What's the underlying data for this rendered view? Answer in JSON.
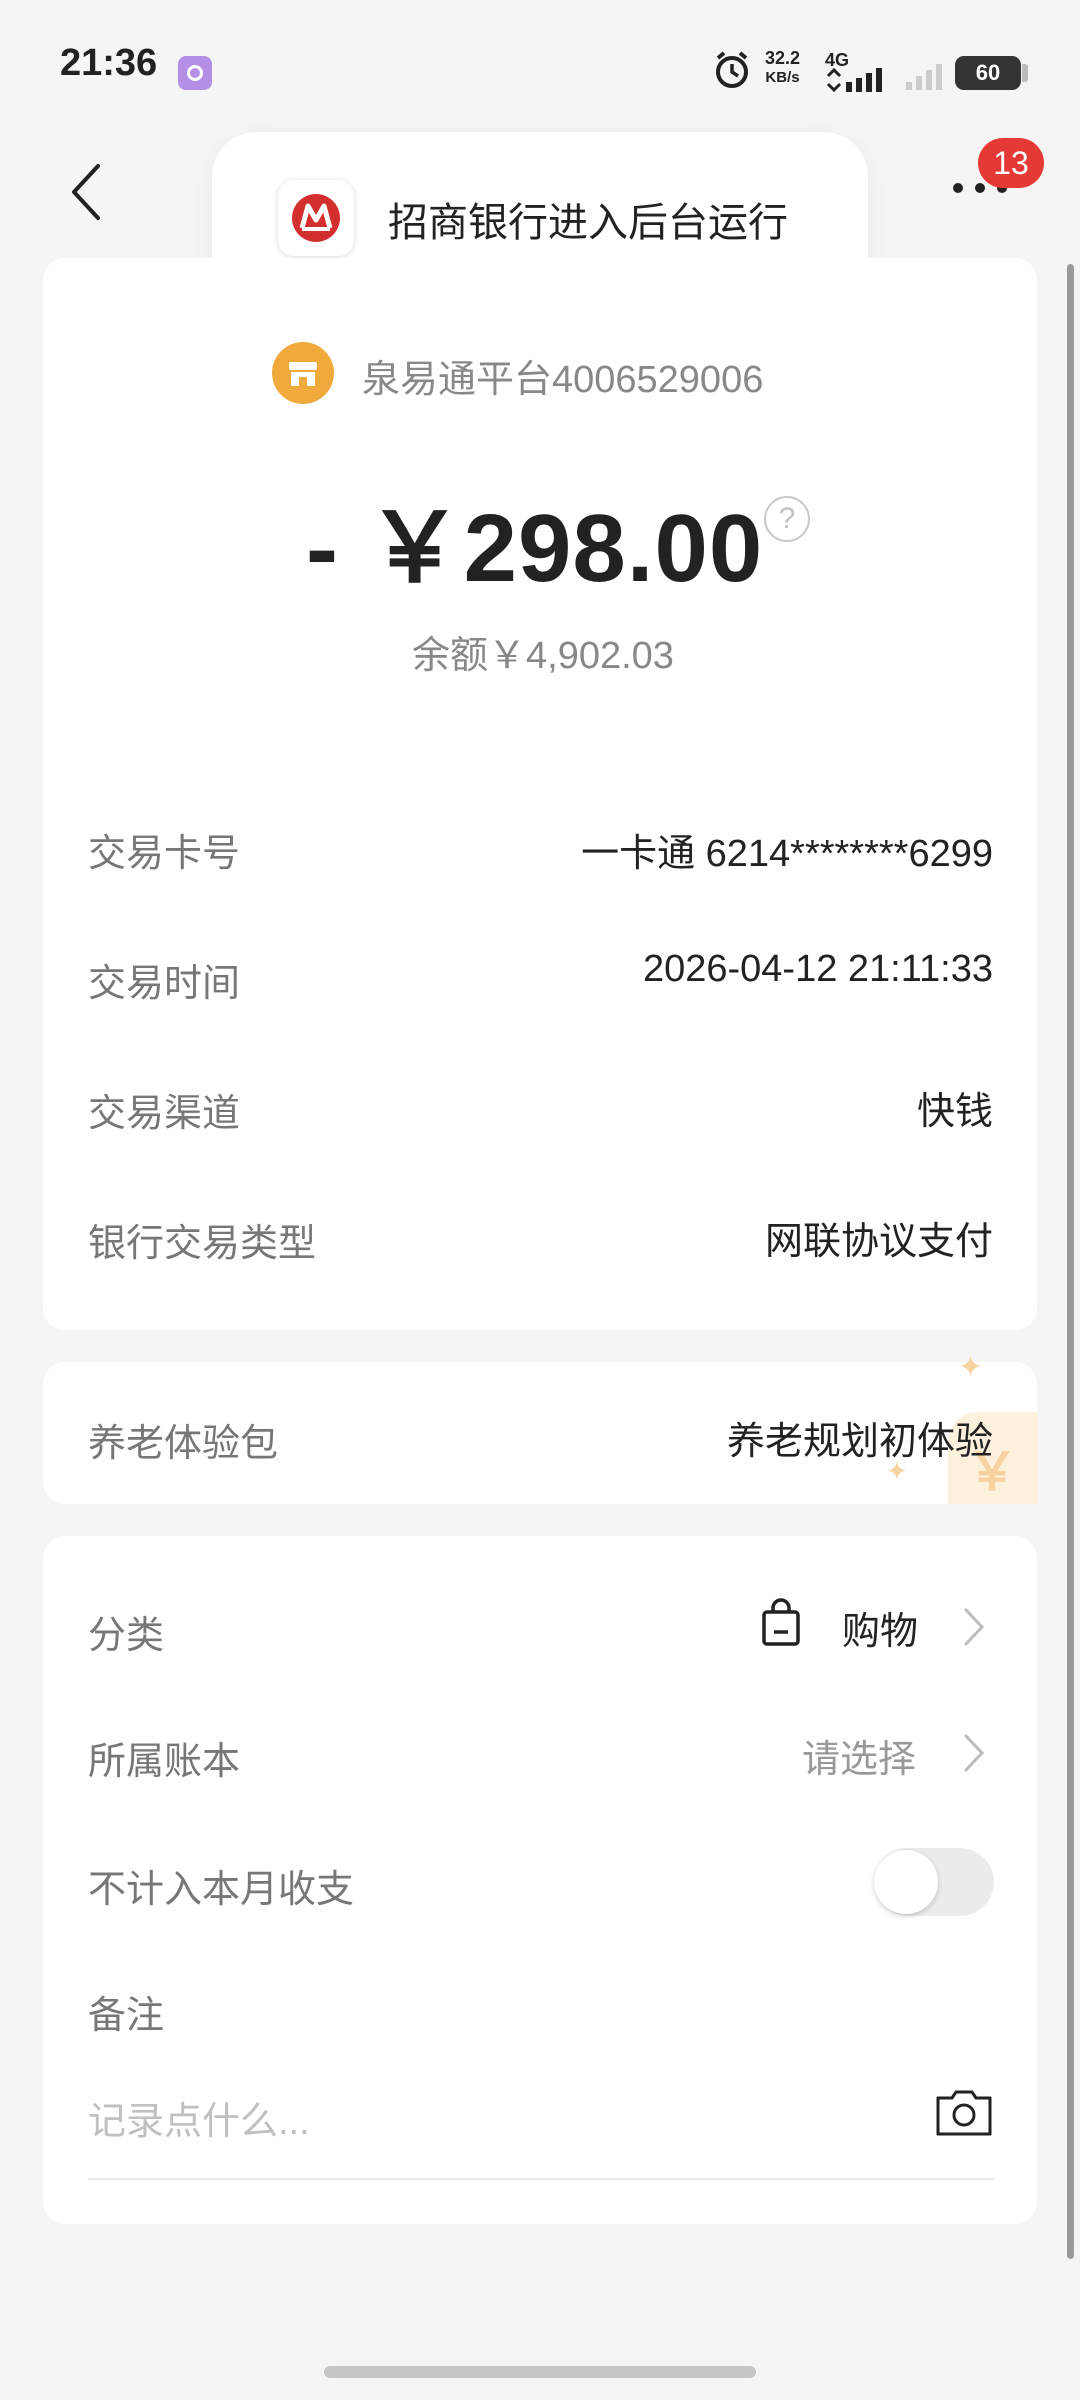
{
  "status_bar": {
    "time": "21:36",
    "net_speed_value": "32.2",
    "net_speed_unit": "KB/s",
    "network_type": "4G",
    "battery": "60"
  },
  "nav": {
    "badge_count": "13"
  },
  "toast": {
    "text": "招商银行进入后台运行"
  },
  "transaction": {
    "merchant": "泉易通平台4006529006",
    "amount": "- ￥298.00",
    "balance": "余额￥4,902.03",
    "details": [
      {
        "label": "交易卡号",
        "value": "一卡通 6214********6299"
      },
      {
        "label": "交易时间",
        "value": "2026-04-12 21:11:33"
      },
      {
        "label": "交易渠道",
        "value": "快钱"
      },
      {
        "label": "银行交易类型",
        "value": "网联协议支付"
      }
    ]
  },
  "pension": {
    "label": "养老体验包",
    "value": "养老规划初体验"
  },
  "settings": {
    "category_label": "分类",
    "category_value": "购物",
    "ledger_label": "所属账本",
    "ledger_value": "请选择",
    "exclude_label": "不计入本月收支",
    "exclude_enabled": false,
    "note_label": "备注",
    "note_placeholder": "记录点什么..."
  },
  "colors": {
    "merchant_icon": "#f0a93b",
    "badge": "#e53935",
    "cmb_red": "#d32f2f"
  },
  "icons": [
    "alarm-icon",
    "back-icon",
    "more-icon",
    "help-icon",
    "shopping-bag-icon",
    "chevron-right-icon",
    "camera-icon",
    "cmb-logo-icon",
    "store-icon"
  ]
}
